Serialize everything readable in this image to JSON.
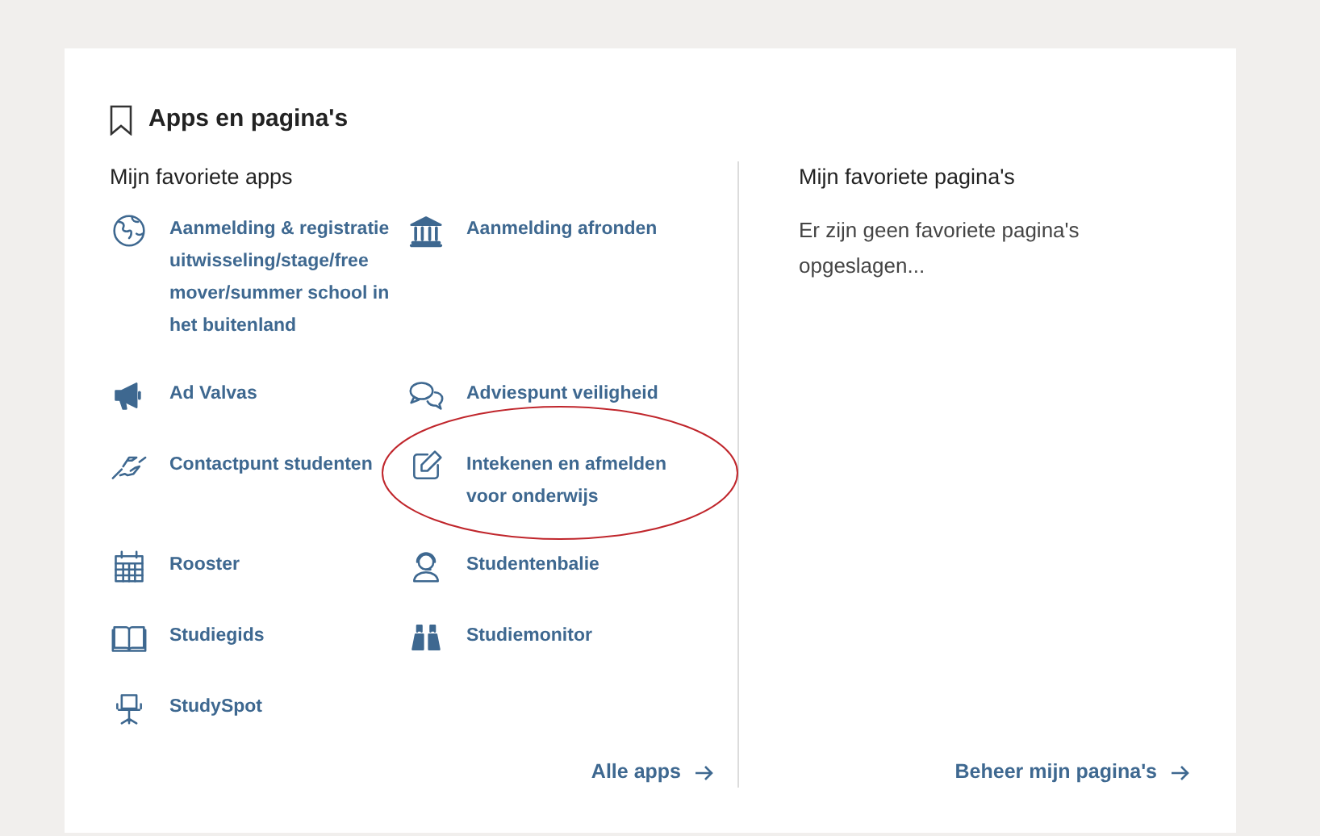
{
  "card": {
    "title": "Apps en pagina's"
  },
  "apps": {
    "heading": "Mijn favoriete apps",
    "items": [
      {
        "label": "Aanmelding & registratie uitwisseling/stage/free mover/summer school in het buitenland"
      },
      {
        "label": "Aanmelding afronden"
      },
      {
        "label": "Ad Valvas"
      },
      {
        "label": "Adviespunt veiligheid"
      },
      {
        "label": "Contactpunt studenten"
      },
      {
        "label": "Intekenen en afmelden voor onderwijs"
      },
      {
        "label": "Rooster"
      },
      {
        "label": "Studentenbalie"
      },
      {
        "label": "Studiegids"
      },
      {
        "label": "Studiemonitor"
      },
      {
        "label": "StudySpot"
      }
    ],
    "link": "Alle apps"
  },
  "pages": {
    "heading": "Mijn favoriete pagina's",
    "empty_text": "Er zijn geen favoriete pagina's opgeslagen...",
    "link": "Beheer mijn pagina's"
  }
}
